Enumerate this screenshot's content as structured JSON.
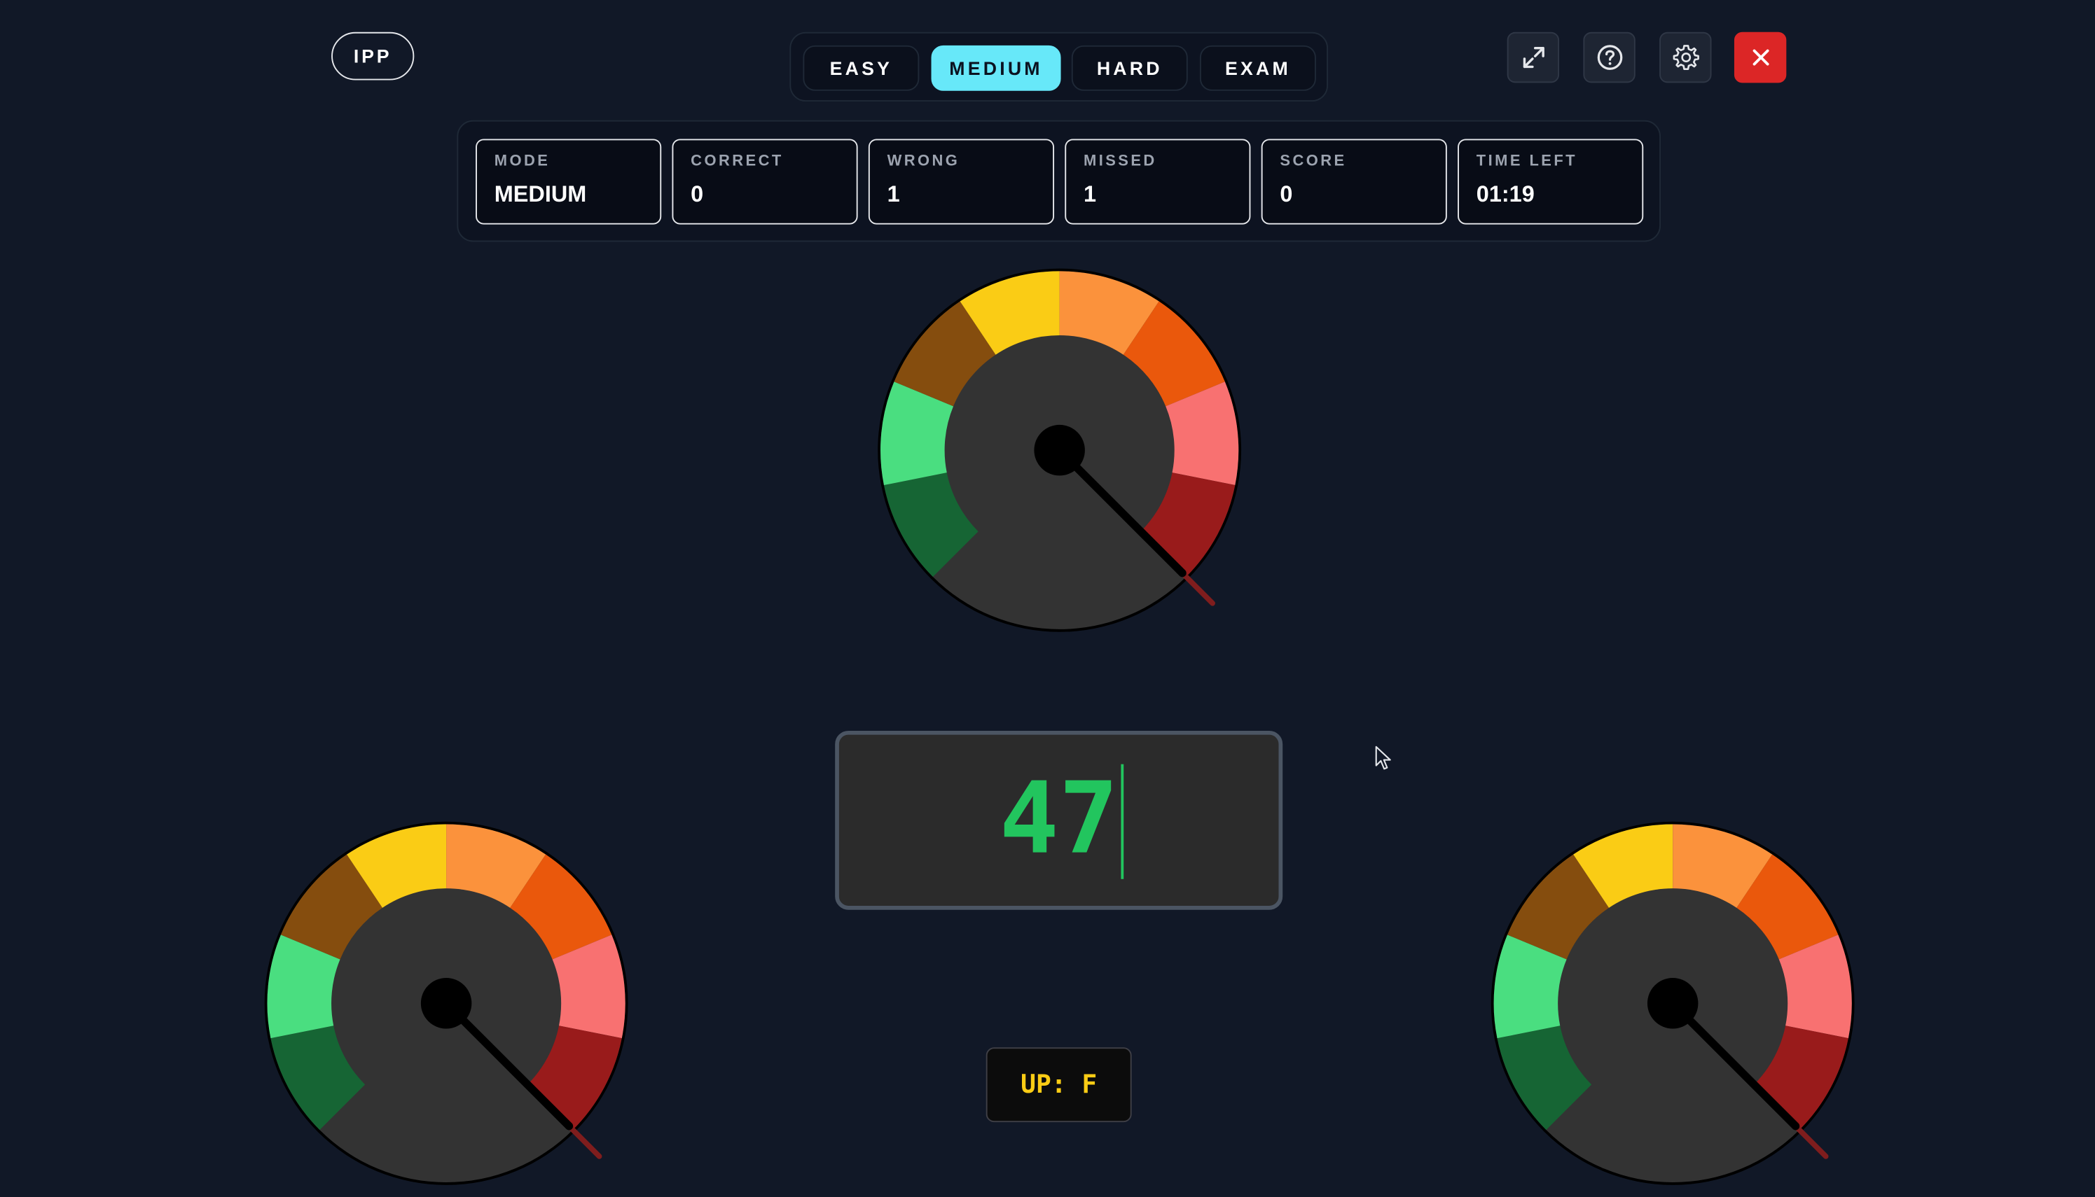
{
  "brand": {
    "label": "IPP"
  },
  "modes": [
    {
      "label": "EASY",
      "active": false
    },
    {
      "label": "MEDIUM",
      "active": true
    },
    {
      "label": "HARD",
      "active": false
    },
    {
      "label": "EXAM",
      "active": false
    }
  ],
  "toolbar": {
    "icons": [
      "expand-icon",
      "help-icon",
      "gear-icon",
      "close-icon"
    ]
  },
  "stats": [
    {
      "label": "MODE",
      "value": "MEDIUM"
    },
    {
      "label": "CORRECT",
      "value": "0"
    },
    {
      "label": "WRONG",
      "value": "1"
    },
    {
      "label": "MISSED",
      "value": "1"
    },
    {
      "label": "SCORE",
      "value": "0"
    },
    {
      "label": "TIME LEFT",
      "value": "01:19"
    }
  ],
  "display": {
    "value": "47"
  },
  "up_indicator": {
    "label": "UP: F"
  },
  "colors": {
    "background": "#111827",
    "accent": "#67e8f9",
    "close": "#dc2626",
    "display_text": "#22c55e",
    "up_text": "#facc15",
    "gauge_segments": [
      "#166534",
      "#4ade80",
      "#854d0e",
      "#facc15",
      "#fb923c",
      "#ea580c",
      "#f87171",
      "#991b1b"
    ]
  }
}
